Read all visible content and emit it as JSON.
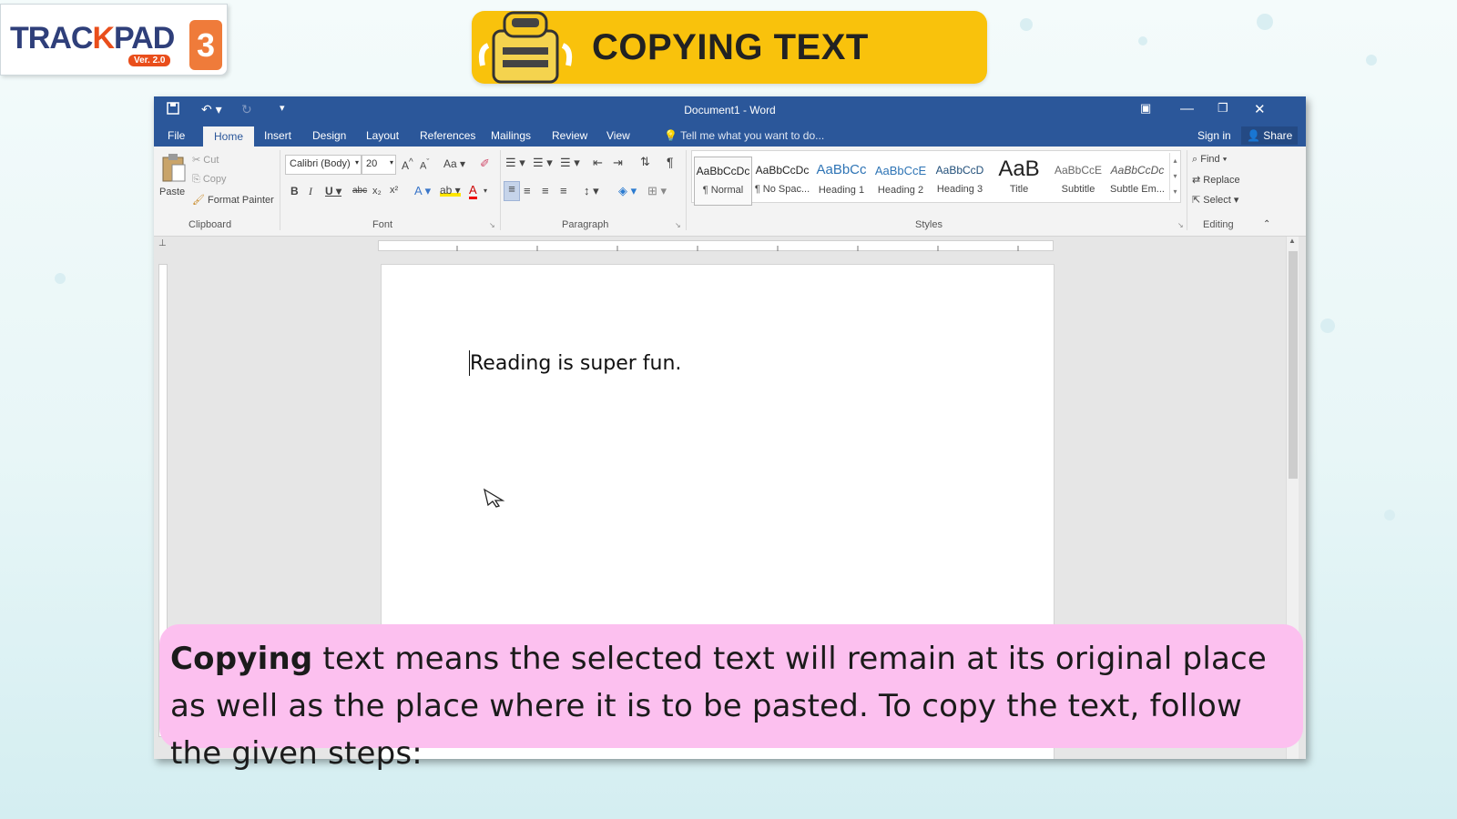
{
  "brand": {
    "logo_word_a": "TRAC",
    "logo_word_k": "K",
    "logo_word_b": "PAD",
    "logo_number": "3",
    "logo_version": "Ver. 2.0"
  },
  "banner": {
    "title": "COPYING TEXT",
    "color": "#f9c20c"
  },
  "window": {
    "title": "Document1 - Word",
    "tabs": [
      "File",
      "Home",
      "Insert",
      "Design",
      "Layout",
      "References",
      "Mailings",
      "Review",
      "View"
    ],
    "active_tab": "Home",
    "tell_me": "Tell me what you want to do...",
    "sign_in": "Sign in",
    "share": "Share",
    "accent": "#2b579a"
  },
  "ribbon": {
    "clipboard": {
      "paste": "Paste",
      "cut": "Cut",
      "copy": "Copy",
      "format_painter": "Format Painter",
      "label": "Clipboard"
    },
    "font": {
      "family": "Calibri (Body)",
      "size": "20",
      "label": "Font"
    },
    "paragraph": {
      "label": "Paragraph"
    },
    "styles": {
      "label": "Styles",
      "items": [
        {
          "preview": "AaBbCcDc",
          "name": "¶ Normal"
        },
        {
          "preview": "AaBbCcDc",
          "name": "¶ No Spac..."
        },
        {
          "preview": "AaBbCc",
          "name": "Heading 1"
        },
        {
          "preview": "AaBbCcE",
          "name": "Heading 2"
        },
        {
          "preview": "AaBbCcD",
          "name": "Heading 3"
        },
        {
          "preview": "AaB",
          "name": "Title"
        },
        {
          "preview": "AaBbCcE",
          "name": "Subtitle"
        },
        {
          "preview": "AaBbCcDc",
          "name": "Subtle Em..."
        }
      ]
    },
    "editing": {
      "find": "Find",
      "replace": "Replace",
      "select": "Select",
      "label": "Editing"
    }
  },
  "document": {
    "text": "Reading is super fun."
  },
  "caption": {
    "bold": "Copying",
    "rest": " text means the selected text will remain at its original place as well as  the place where it is to be pasted. To copy the text, follow the given steps:"
  }
}
